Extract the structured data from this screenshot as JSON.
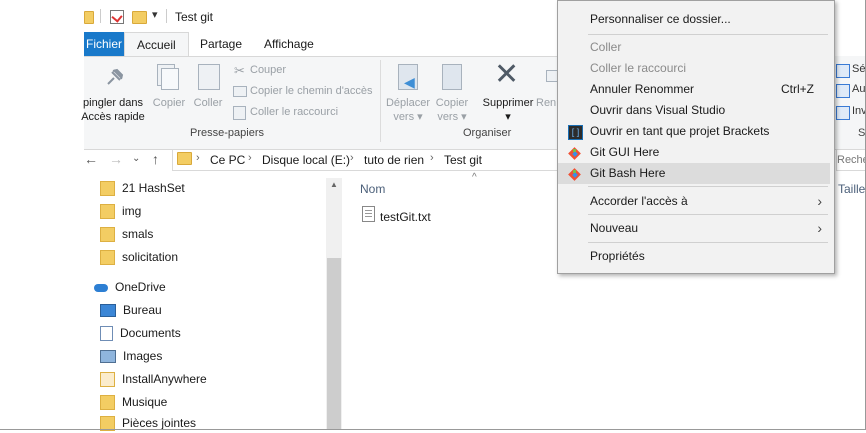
{
  "window": {
    "title": "Test git"
  },
  "tabs": {
    "fichier": "Fichier",
    "accueil": "Accueil",
    "partage": "Partage",
    "affichage": "Affichage"
  },
  "ribbon": {
    "epingler": "Épingler dans Accès rapide",
    "epingler_l1": "pingler dans",
    "epingler_l2": "Accès rapide",
    "copier": "Copier",
    "coller": "Coller",
    "couper": "Couper",
    "copier_chemin": "Copier le chemin d'accès",
    "coller_raccourci": "Coller le raccourci",
    "presse_papiers": "Presse-papiers",
    "deplacer_l1": "Déplacer",
    "deplacer_l2": "vers ▾",
    "copier_vers_l1": "Copier",
    "copier_vers_l2": "vers ▾",
    "supprimer": "Supprimer",
    "supprimer_caret": "▾",
    "renommer": "Ren",
    "organiser": "Organiser",
    "right_sel": "Sél",
    "right_au": "Au",
    "right_inv": "Inv",
    "right_s": "S"
  },
  "address": {
    "crumbs": [
      "Ce PC",
      "Disque local (E:)",
      "tuto de rien",
      "Test git"
    ],
    "search_placeholder": "Rechercher dans"
  },
  "nav": {
    "items": [
      {
        "label": "21 HashSet",
        "icon": "folder-icon"
      },
      {
        "label": "img",
        "icon": "folder-icon"
      },
      {
        "label": "smals",
        "icon": "folder-icon"
      },
      {
        "label": "solicitation",
        "icon": "folder-icon"
      },
      {
        "label": "OneDrive",
        "icon": "cloud-icon"
      },
      {
        "label": "Bureau",
        "icon": "desktop-icon"
      },
      {
        "label": "Documents",
        "icon": "documents-icon"
      },
      {
        "label": "Images",
        "icon": "pictures-icon"
      },
      {
        "label": "InstallAnywhere",
        "icon": "folder-icon"
      },
      {
        "label": "Musique",
        "icon": "folder-icon"
      },
      {
        "label": "Pièces jointes",
        "icon": "folder-icon"
      }
    ]
  },
  "content": {
    "col_nom": "Nom",
    "col_taille": "Taille",
    "files": [
      {
        "name": "testGit.txt",
        "icon": "text-file-icon"
      }
    ]
  },
  "context_menu": {
    "items": [
      {
        "label": "Personnaliser ce dossier...",
        "disabled": false
      },
      {
        "label": "Coller",
        "disabled": true
      },
      {
        "label": "Coller le raccourci",
        "disabled": true
      },
      {
        "label": "Annuler Renommer",
        "shortcut": "Ctrl+Z",
        "disabled": false
      },
      {
        "label": "Ouvrir dans Visual Studio",
        "disabled": false
      },
      {
        "label": "Ouvrir en tant que projet Brackets",
        "icon": "brackets-icon",
        "disabled": false
      },
      {
        "label": "Git GUI Here",
        "icon": "git-icon",
        "disabled": false
      },
      {
        "label": "Git Bash Here",
        "icon": "git-icon",
        "disabled": false,
        "highlighted": true
      },
      {
        "label": "Accorder l'accès à",
        "submenu": true
      },
      {
        "label": "Nouveau",
        "submenu": true
      },
      {
        "label": "Propriétés",
        "disabled": false
      }
    ]
  },
  "colors": {
    "accent": "#1979ca",
    "folder": "#f3cd63",
    "menu_bg": "#f2f2f2",
    "highlight": "#dcdcdc"
  }
}
